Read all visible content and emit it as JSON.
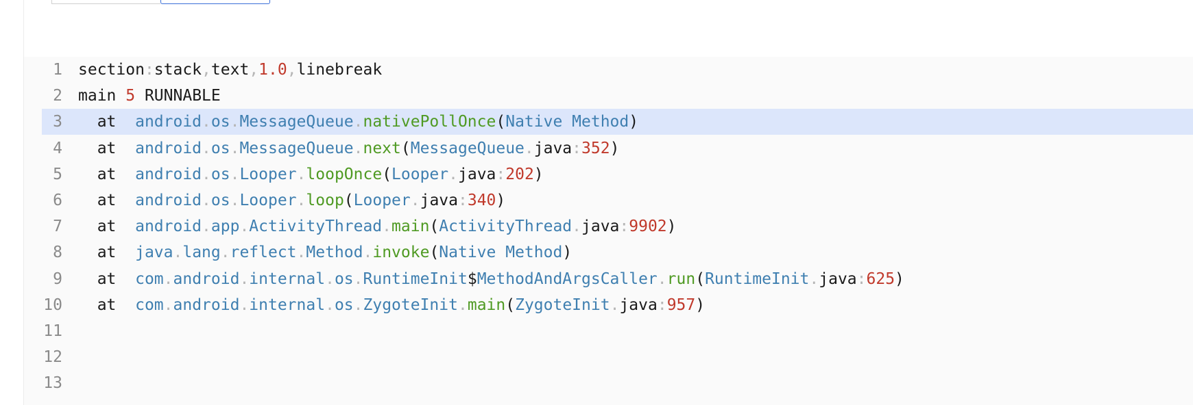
{
  "tabs": [
    {
      "label": "",
      "selected": false
    },
    {
      "label": "",
      "selected": true
    }
  ],
  "editor": {
    "active_line": 3,
    "lines": [
      {
        "number": "1",
        "segments": [
          {
            "text": "section",
            "kind": "plain"
          },
          {
            "text": ":",
            "kind": "dim"
          },
          {
            "text": "stack",
            "kind": "plain"
          },
          {
            "text": ",",
            "kind": "dim"
          },
          {
            "text": "text",
            "kind": "plain"
          },
          {
            "text": ",",
            "kind": "dim"
          },
          {
            "text": "1.0",
            "kind": "num"
          },
          {
            "text": ",",
            "kind": "dim"
          },
          {
            "text": "linebreak",
            "kind": "plain"
          }
        ]
      },
      {
        "number": "2",
        "segments": [
          {
            "text": "main ",
            "kind": "plain"
          },
          {
            "text": "5",
            "kind": "num"
          },
          {
            "text": " RUNNABLE",
            "kind": "plain"
          }
        ]
      },
      {
        "number": "3",
        "segments": [
          {
            "text": "  at  ",
            "kind": "plain"
          },
          {
            "text": "android",
            "kind": "pkg"
          },
          {
            "text": ".",
            "kind": "dim"
          },
          {
            "text": "os",
            "kind": "pkg"
          },
          {
            "text": ".",
            "kind": "dim"
          },
          {
            "text": "MessageQueue",
            "kind": "pkg"
          },
          {
            "text": ".",
            "kind": "dim"
          },
          {
            "text": "nativePollOnce",
            "kind": "fn"
          },
          {
            "text": "(",
            "kind": "plain"
          },
          {
            "text": "Native Method",
            "kind": "pkg"
          },
          {
            "text": ")",
            "kind": "plain"
          }
        ]
      },
      {
        "number": "4",
        "segments": [
          {
            "text": "  at  ",
            "kind": "plain"
          },
          {
            "text": "android",
            "kind": "pkg"
          },
          {
            "text": ".",
            "kind": "dim"
          },
          {
            "text": "os",
            "kind": "pkg"
          },
          {
            "text": ".",
            "kind": "dim"
          },
          {
            "text": "MessageQueue",
            "kind": "pkg"
          },
          {
            "text": ".",
            "kind": "dim"
          },
          {
            "text": "next",
            "kind": "fn"
          },
          {
            "text": "(",
            "kind": "plain"
          },
          {
            "text": "MessageQueue",
            "kind": "pkg"
          },
          {
            "text": ".",
            "kind": "dim"
          },
          {
            "text": "java",
            "kind": "plain"
          },
          {
            "text": ":",
            "kind": "dim"
          },
          {
            "text": "352",
            "kind": "num"
          },
          {
            "text": ")",
            "kind": "plain"
          }
        ]
      },
      {
        "number": "5",
        "segments": [
          {
            "text": "  at  ",
            "kind": "plain"
          },
          {
            "text": "android",
            "kind": "pkg"
          },
          {
            "text": ".",
            "kind": "dim"
          },
          {
            "text": "os",
            "kind": "pkg"
          },
          {
            "text": ".",
            "kind": "dim"
          },
          {
            "text": "Looper",
            "kind": "pkg"
          },
          {
            "text": ".",
            "kind": "dim"
          },
          {
            "text": "loopOnce",
            "kind": "fn"
          },
          {
            "text": "(",
            "kind": "plain"
          },
          {
            "text": "Looper",
            "kind": "pkg"
          },
          {
            "text": ".",
            "kind": "dim"
          },
          {
            "text": "java",
            "kind": "plain"
          },
          {
            "text": ":",
            "kind": "dim"
          },
          {
            "text": "202",
            "kind": "num"
          },
          {
            "text": ")",
            "kind": "plain"
          }
        ]
      },
      {
        "number": "6",
        "segments": [
          {
            "text": "  at  ",
            "kind": "plain"
          },
          {
            "text": "android",
            "kind": "pkg"
          },
          {
            "text": ".",
            "kind": "dim"
          },
          {
            "text": "os",
            "kind": "pkg"
          },
          {
            "text": ".",
            "kind": "dim"
          },
          {
            "text": "Looper",
            "kind": "pkg"
          },
          {
            "text": ".",
            "kind": "dim"
          },
          {
            "text": "loop",
            "kind": "fn"
          },
          {
            "text": "(",
            "kind": "plain"
          },
          {
            "text": "Looper",
            "kind": "pkg"
          },
          {
            "text": ".",
            "kind": "dim"
          },
          {
            "text": "java",
            "kind": "plain"
          },
          {
            "text": ":",
            "kind": "dim"
          },
          {
            "text": "340",
            "kind": "num"
          },
          {
            "text": ")",
            "kind": "plain"
          }
        ]
      },
      {
        "number": "7",
        "segments": [
          {
            "text": "  at  ",
            "kind": "plain"
          },
          {
            "text": "android",
            "kind": "pkg"
          },
          {
            "text": ".",
            "kind": "dim"
          },
          {
            "text": "app",
            "kind": "pkg"
          },
          {
            "text": ".",
            "kind": "dim"
          },
          {
            "text": "ActivityThread",
            "kind": "pkg"
          },
          {
            "text": ".",
            "kind": "dim"
          },
          {
            "text": "main",
            "kind": "fn"
          },
          {
            "text": "(",
            "kind": "plain"
          },
          {
            "text": "ActivityThread",
            "kind": "pkg"
          },
          {
            "text": ".",
            "kind": "dim"
          },
          {
            "text": "java",
            "kind": "plain"
          },
          {
            "text": ":",
            "kind": "dim"
          },
          {
            "text": "9902",
            "kind": "num"
          },
          {
            "text": ")",
            "kind": "plain"
          }
        ]
      },
      {
        "number": "8",
        "segments": [
          {
            "text": "  at  ",
            "kind": "plain"
          },
          {
            "text": "java",
            "kind": "pkg"
          },
          {
            "text": ".",
            "kind": "dim"
          },
          {
            "text": "lang",
            "kind": "pkg"
          },
          {
            "text": ".",
            "kind": "dim"
          },
          {
            "text": "reflect",
            "kind": "pkg"
          },
          {
            "text": ".",
            "kind": "dim"
          },
          {
            "text": "Method",
            "kind": "pkg"
          },
          {
            "text": ".",
            "kind": "dim"
          },
          {
            "text": "invoke",
            "kind": "fn"
          },
          {
            "text": "(",
            "kind": "plain"
          },
          {
            "text": "Native Method",
            "kind": "pkg"
          },
          {
            "text": ")",
            "kind": "plain"
          }
        ]
      },
      {
        "number": "9",
        "segments": [
          {
            "text": "  at  ",
            "kind": "plain"
          },
          {
            "text": "com",
            "kind": "pkg"
          },
          {
            "text": ".",
            "kind": "dim"
          },
          {
            "text": "android",
            "kind": "pkg"
          },
          {
            "text": ".",
            "kind": "dim"
          },
          {
            "text": "internal",
            "kind": "pkg"
          },
          {
            "text": ".",
            "kind": "dim"
          },
          {
            "text": "os",
            "kind": "pkg"
          },
          {
            "text": ".",
            "kind": "dim"
          },
          {
            "text": "RuntimeInit",
            "kind": "pkg"
          },
          {
            "text": "$",
            "kind": "plain"
          },
          {
            "text": "MethodAndArgsCaller",
            "kind": "pkg"
          },
          {
            "text": ".",
            "kind": "dim"
          },
          {
            "text": "run",
            "kind": "fn"
          },
          {
            "text": "(",
            "kind": "plain"
          },
          {
            "text": "RuntimeInit",
            "kind": "pkg"
          },
          {
            "text": ".",
            "kind": "dim"
          },
          {
            "text": "java",
            "kind": "plain"
          },
          {
            "text": ":",
            "kind": "dim"
          },
          {
            "text": "625",
            "kind": "num"
          },
          {
            "text": ")",
            "kind": "plain"
          }
        ]
      },
      {
        "number": "10",
        "segments": [
          {
            "text": "  at  ",
            "kind": "plain"
          },
          {
            "text": "com",
            "kind": "pkg"
          },
          {
            "text": ".",
            "kind": "dim"
          },
          {
            "text": "android",
            "kind": "pkg"
          },
          {
            "text": ".",
            "kind": "dim"
          },
          {
            "text": "internal",
            "kind": "pkg"
          },
          {
            "text": ".",
            "kind": "dim"
          },
          {
            "text": "os",
            "kind": "pkg"
          },
          {
            "text": ".",
            "kind": "dim"
          },
          {
            "text": "ZygoteInit",
            "kind": "pkg"
          },
          {
            "text": ".",
            "kind": "dim"
          },
          {
            "text": "main",
            "kind": "fn"
          },
          {
            "text": "(",
            "kind": "plain"
          },
          {
            "text": "ZygoteInit",
            "kind": "pkg"
          },
          {
            "text": ".",
            "kind": "dim"
          },
          {
            "text": "java",
            "kind": "plain"
          },
          {
            "text": ":",
            "kind": "dim"
          },
          {
            "text": "957",
            "kind": "num"
          },
          {
            "text": ")",
            "kind": "plain"
          }
        ]
      },
      {
        "number": "11",
        "segments": []
      },
      {
        "number": "12",
        "segments": []
      },
      {
        "number": "13",
        "segments": []
      }
    ]
  },
  "colors": {
    "keyword_plain": "#1a1a1a",
    "punctuation": "#b6b6b6",
    "number": "#c0392b",
    "package": "#3f7fb0",
    "function": "#4f9a23",
    "active_line_bg": "#dce6fb",
    "editor_bg": "#fafafa",
    "line_number": "#8a8a8a"
  }
}
